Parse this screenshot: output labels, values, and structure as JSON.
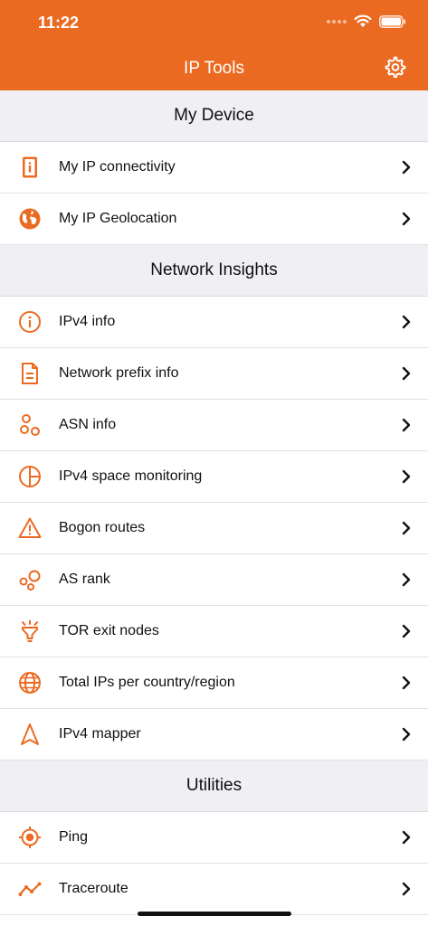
{
  "status": {
    "time": "11:22"
  },
  "header": {
    "title": "IP Tools"
  },
  "colors": {
    "accent": "#EB6A22",
    "section_bg": "#EFEFF4",
    "text": "#111111"
  },
  "sections": [
    {
      "title": "My Device",
      "items": [
        {
          "label": "My IP connectivity",
          "icon": "phone-info-icon"
        },
        {
          "label": "My IP Geolocation",
          "icon": "globe-filled-icon"
        }
      ]
    },
    {
      "title": "Network Insights",
      "items": [
        {
          "label": "IPv4 info",
          "icon": "info-circle-icon"
        },
        {
          "label": "Network prefix info",
          "icon": "document-icon"
        },
        {
          "label": "ASN info",
          "icon": "nodes-icon"
        },
        {
          "label": "IPv4 space monitoring",
          "icon": "pie-chart-icon"
        },
        {
          "label": "Bogon routes",
          "icon": "warning-icon"
        },
        {
          "label": "AS rank",
          "icon": "bubbles-icon"
        },
        {
          "label": "TOR exit nodes",
          "icon": "lamp-icon"
        },
        {
          "label": "Total IPs per country/region",
          "icon": "globe-outline-icon"
        },
        {
          "label": "IPv4 mapper",
          "icon": "navigation-arrow-icon"
        }
      ]
    },
    {
      "title": "Utilities",
      "items": [
        {
          "label": "Ping",
          "icon": "target-icon"
        },
        {
          "label": "Traceroute",
          "icon": "route-line-icon"
        }
      ]
    }
  ]
}
